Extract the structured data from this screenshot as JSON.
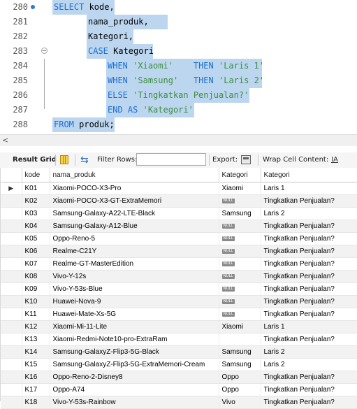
{
  "editor": {
    "lines": [
      {
        "num": "280",
        "tokens": [
          {
            "t": "SELECT",
            "c": "kw"
          },
          {
            "t": " kode,",
            "c": ""
          }
        ]
      },
      {
        "num": "281",
        "tokens": [
          {
            "t": "nama_produk,",
            "c": ""
          }
        ]
      },
      {
        "num": "282",
        "tokens": [
          {
            "t": "Kategori,",
            "c": ""
          }
        ]
      },
      {
        "num": "283",
        "tokens": [
          {
            "t": "CASE",
            "c": "kw"
          },
          {
            "t": " Kategori",
            "c": ""
          }
        ]
      },
      {
        "num": "284",
        "tokens": [
          {
            "t": "WHEN",
            "c": "kw"
          },
          {
            "t": " ",
            "c": ""
          },
          {
            "t": "'Xiaomi'",
            "c": "str"
          },
          {
            "t": "    ",
            "c": ""
          },
          {
            "t": "THEN",
            "c": "kw"
          },
          {
            "t": " ",
            "c": ""
          },
          {
            "t": "'Laris 1'",
            "c": "str"
          }
        ]
      },
      {
        "num": "285",
        "tokens": [
          {
            "t": "WHEN",
            "c": "kw"
          },
          {
            "t": " ",
            "c": ""
          },
          {
            "t": "'Samsung'",
            "c": "str"
          },
          {
            "t": "   ",
            "c": ""
          },
          {
            "t": "THEN",
            "c": "kw"
          },
          {
            "t": " ",
            "c": ""
          },
          {
            "t": "'Laris 2'",
            "c": "str"
          }
        ]
      },
      {
        "num": "286",
        "tokens": [
          {
            "t": "ELSE",
            "c": "kw"
          },
          {
            "t": " ",
            "c": ""
          },
          {
            "t": "'Tingkatkan Penjualan?'",
            "c": "str"
          }
        ]
      },
      {
        "num": "287",
        "tokens": [
          {
            "t": "END",
            "c": "kw"
          },
          {
            "t": " ",
            "c": ""
          },
          {
            "t": "AS",
            "c": "kw"
          },
          {
            "t": " ",
            "c": ""
          },
          {
            "t": "'Kategori'",
            "c": "str"
          }
        ]
      },
      {
        "num": "288",
        "tokens": [
          {
            "t": "FROM",
            "c": "kw"
          },
          {
            "t": " produk;",
            "c": ""
          }
        ]
      }
    ],
    "scroll_arrow": "<"
  },
  "toolbar": {
    "result_grid": "Result Grid",
    "filter_rows": "Filter Rows:",
    "filter_value": "",
    "export": "Export:",
    "wrap_cell": "Wrap Cell Content:",
    "wrap_icon_glyph": "IA"
  },
  "grid": {
    "columns": [
      "kode",
      "nama_produk",
      "Kategori",
      "Kategori"
    ],
    "null_label": "NULL",
    "current_row_marker": "▶",
    "rows": [
      [
        "K01",
        "Xiaomi-POCO-X3-Pro",
        "Xiaomi",
        "Laris 1"
      ],
      [
        "K02",
        "Xiaomi-POCO-X3-GT-ExtraMemori",
        null,
        "Tingkatkan Penjualan?"
      ],
      [
        "K03",
        "Samsung-Galaxy-A22-LTE-Black",
        "Samsung",
        "Laris 2"
      ],
      [
        "K04",
        "Samsung-Galaxy-A12-Blue",
        null,
        "Tingkatkan Penjualan?"
      ],
      [
        "K05",
        "Oppo-Reno-5",
        null,
        "Tingkatkan Penjualan?"
      ],
      [
        "K06",
        "Realme-C21Y",
        null,
        "Tingkatkan Penjualan?"
      ],
      [
        "K07",
        "Realme-GT-MasterEdition",
        null,
        "Tingkatkan Penjualan?"
      ],
      [
        "K08",
        "Vivo-Y-12s",
        null,
        "Tingkatkan Penjualan?"
      ],
      [
        "K09",
        "Vivo-Y-53s-Blue",
        null,
        "Tingkatkan Penjualan?"
      ],
      [
        "K10",
        "Huawei-Nova-9",
        null,
        "Tingkatkan Penjualan?"
      ],
      [
        "K11",
        "Huawei-Mate-Xs-5G",
        null,
        "Tingkatkan Penjualan?"
      ],
      [
        "K12",
        "Xiaomi-Mi-11-Lite",
        "Xiaomi",
        "Laris 1"
      ],
      [
        "K13",
        "Xiaomi-Redmi-Note10-pro-ExtraRam",
        "",
        "Tingkatkan Penjualan?"
      ],
      [
        "K14",
        "Samsung-GalaxyZ-Flip3-5G-Black",
        "Samsung",
        "Laris 2"
      ],
      [
        "K15",
        "Samsung-GalaxyZ-Flip3-5G-ExtraMemori-Cream",
        "Samsung",
        "Laris 2"
      ],
      [
        "K16",
        "Oppo-Reno-2-Disney8",
        "Oppo",
        "Tingkatkan Penjualan?"
      ],
      [
        "K17",
        "Oppo-A74",
        "Oppo",
        "Tingkatkan Penjualan?"
      ],
      [
        "K18",
        "Vivo-Y-53s-Rainbow",
        "Vivo",
        "Tingkatkan Penjualan?"
      ]
    ]
  }
}
